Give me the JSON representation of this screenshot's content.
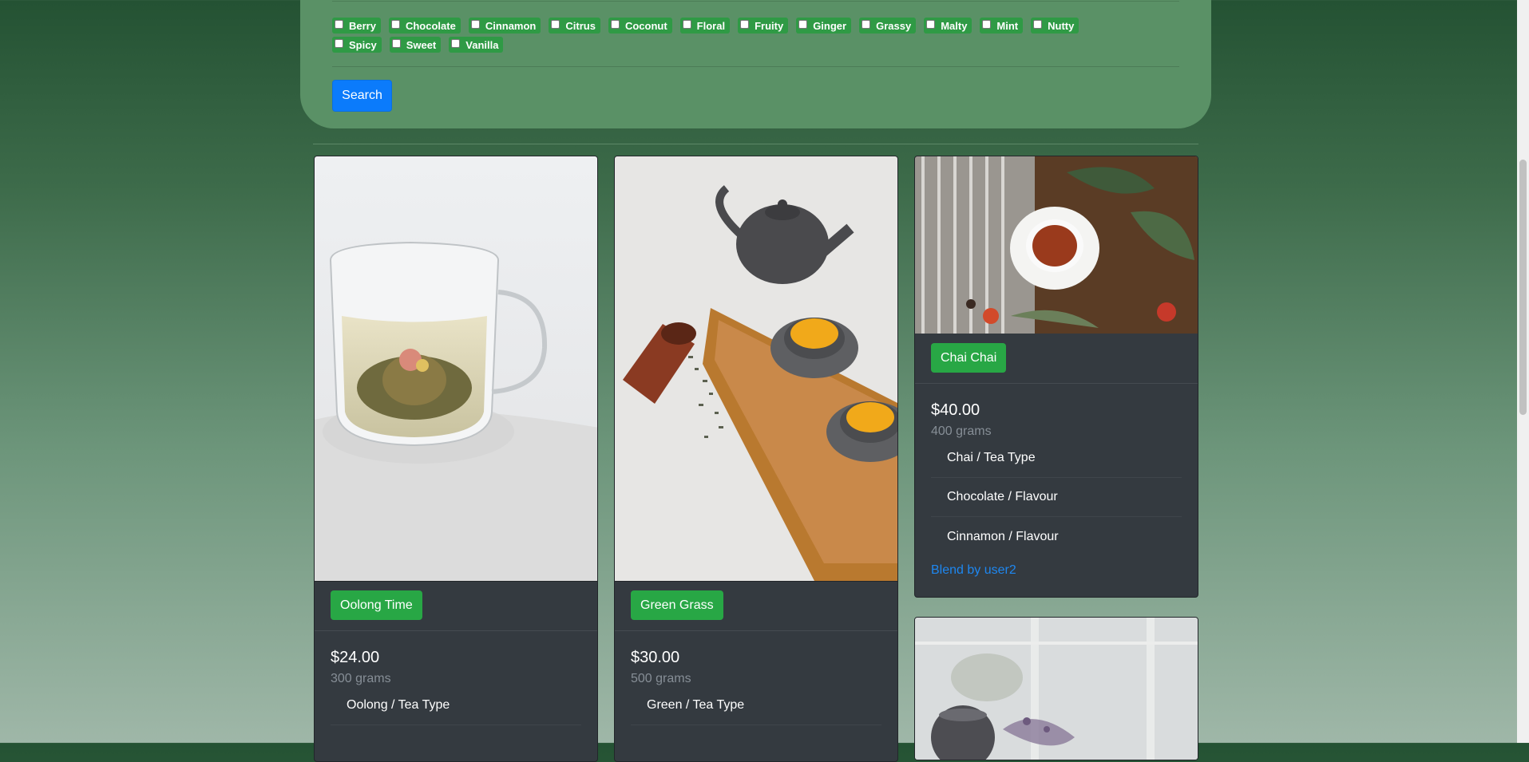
{
  "filters": {
    "flavours_row1": [
      "Berry",
      "Chocolate",
      "Cinnamon",
      "Citrus",
      "Coconut",
      "Floral",
      "Fruity",
      "Ginger",
      "Grassy",
      "Malty",
      "Mint",
      "Nutty"
    ],
    "flavours_row2": [
      "Spicy",
      "Sweet",
      "Vanilla"
    ],
    "search_label": "Search"
  },
  "cards": [
    {
      "name": "Oolong Time",
      "price": "$24.00",
      "weight": "300 grams",
      "attributes": [
        "Oolong / Tea Type"
      ]
    },
    {
      "name": "Green Grass",
      "price": "$30.00",
      "weight": "500 grams",
      "attributes": [
        "Green / Tea Type"
      ]
    },
    {
      "name": "Chai Chai",
      "price": "$40.00",
      "weight": "400 grams",
      "attributes": [
        "Chai / Tea Type",
        "Chocolate / Flavour",
        "Cinnamon / Flavour"
      ],
      "blend": "Blend by user2"
    }
  ],
  "colors": {
    "accent_green": "#28a745",
    "search_blue": "#0b7bfb",
    "link_blue": "#1e87f0",
    "card_bg": "#343a40"
  }
}
